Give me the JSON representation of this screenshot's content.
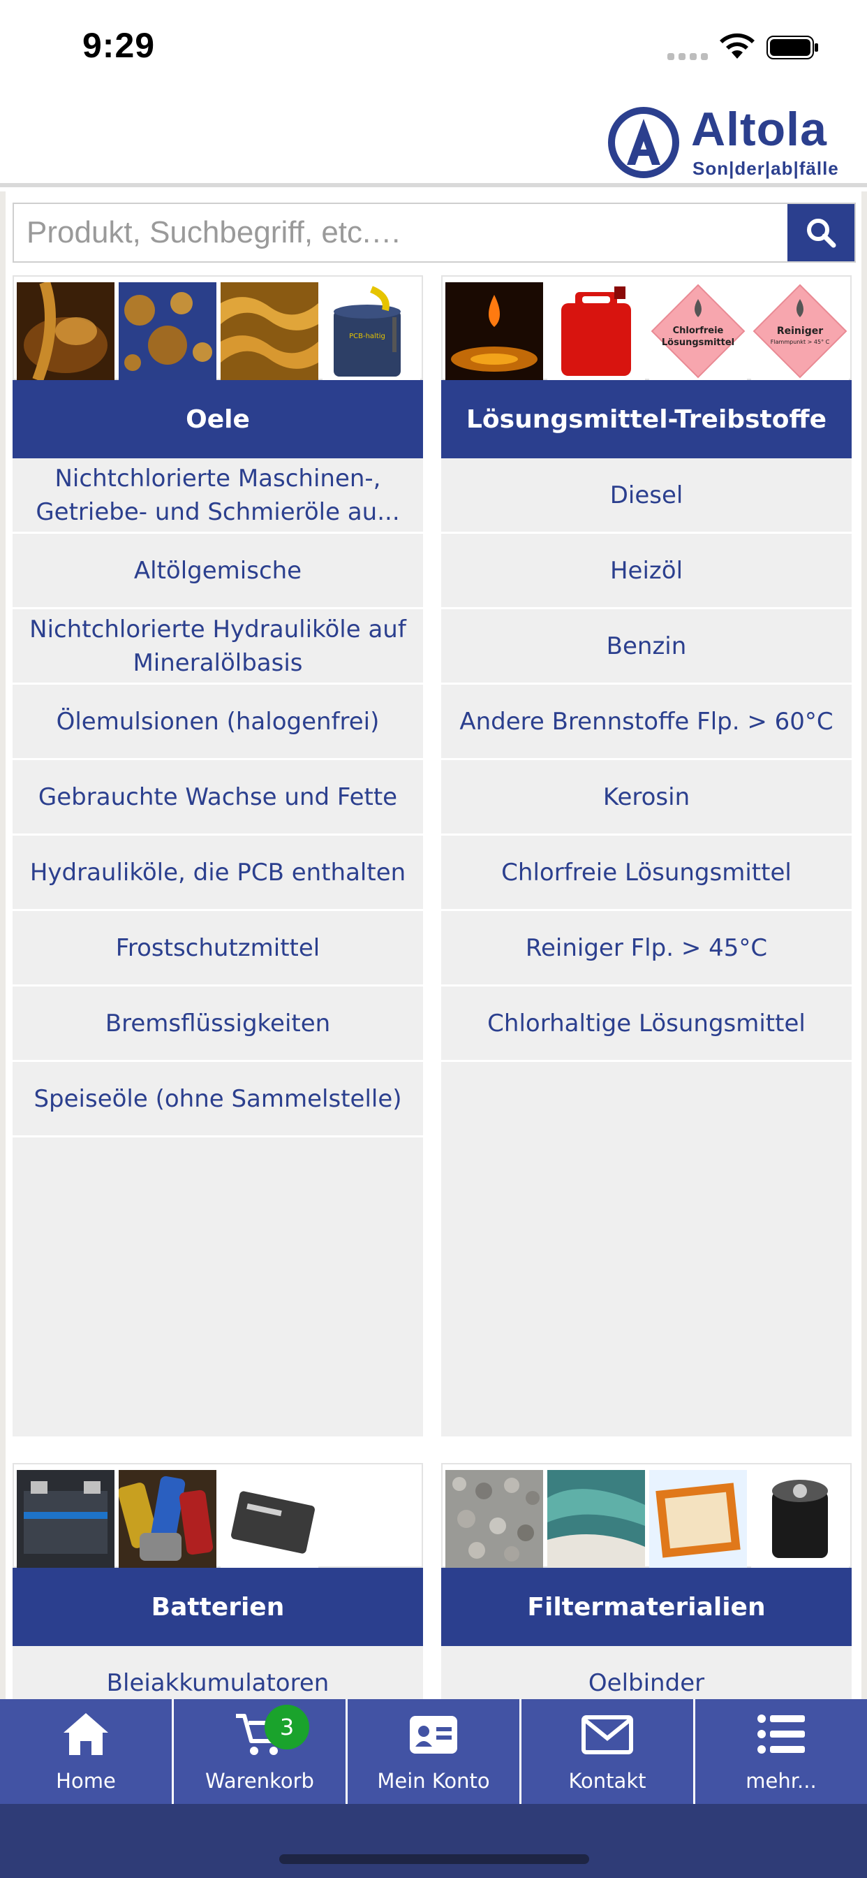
{
  "status_bar": {
    "time": "9:29"
  },
  "header": {
    "logo_text": "Altola",
    "logo_subtitle": "Son|der|ab|fälle"
  },
  "search": {
    "placeholder": "Produkt, Suchbegriff, etc.…",
    "value": ""
  },
  "categories": [
    {
      "title": "Oele",
      "thumbnails": [
        "oil-pour-image",
        "oil-bubbles-image",
        "grease-image",
        "pcb-barrel-image"
      ],
      "thumbnail_caption": "PCB-haltig",
      "items": [
        "Nichtchlorierte Maschinen-, Getriebe- und Schmieröle au...",
        "Altölgemische",
        "Nichtchlorierte Hydrauliköle auf Mineralölbasis",
        "Ölemulsionen (halogenfrei)",
        "Gebrauchte Wachse und Fette",
        "Hydrauliköle, die PCB enthalten",
        "Frostschutzmittel",
        "Bremsflüssigkeiten",
        "Speiseöle (ohne Sammelstelle)"
      ]
    },
    {
      "title": "Lösungsmittel-Treibstoffe",
      "thumbnails": [
        "fuel-drop-image",
        "red-canister-image",
        "hazard-chlorfreie-image",
        "hazard-reiniger-image"
      ],
      "hazard_labels": [
        "Chlorfreie Lösungsmittel",
        "Reiniger",
        "Flammpunkt > 45° C"
      ],
      "items": [
        "Diesel",
        "Heizöl",
        "Benzin",
        "Andere Brennstoffe Flp. > 60°C",
        "Kerosin",
        "Chlorfreie Lösungsmittel",
        "Reiniger Flp. > 45°C",
        "Chlorhaltige Lösungsmittel"
      ]
    },
    {
      "title": "Batterien",
      "thumbnails": [
        "car-battery-image",
        "mixed-batteries-image",
        "phone-battery-image"
      ],
      "items": [
        "Bleiakkumulatoren"
      ]
    },
    {
      "title": "Filtermaterialien",
      "thumbnails": [
        "binder-granules-image",
        "cloth-rags-image",
        "air-filter-image",
        "oil-filter-image"
      ],
      "items": [
        "Oelbinder"
      ]
    }
  ],
  "tabbar": {
    "tabs": [
      {
        "label": "Home",
        "icon": "home-icon"
      },
      {
        "label": "Warenkorb",
        "icon": "cart-icon",
        "badge": "3"
      },
      {
        "label": "Mein Konto",
        "icon": "account-card-icon"
      },
      {
        "label": "Kontakt",
        "icon": "mail-icon"
      },
      {
        "label": "mehr...",
        "icon": "list-icon"
      }
    ]
  },
  "colors": {
    "brand_blue": "#2b3f8e",
    "tabbar_blue": "#4253a4",
    "list_background": "#efefef",
    "badge_green": "#1aa32c"
  }
}
